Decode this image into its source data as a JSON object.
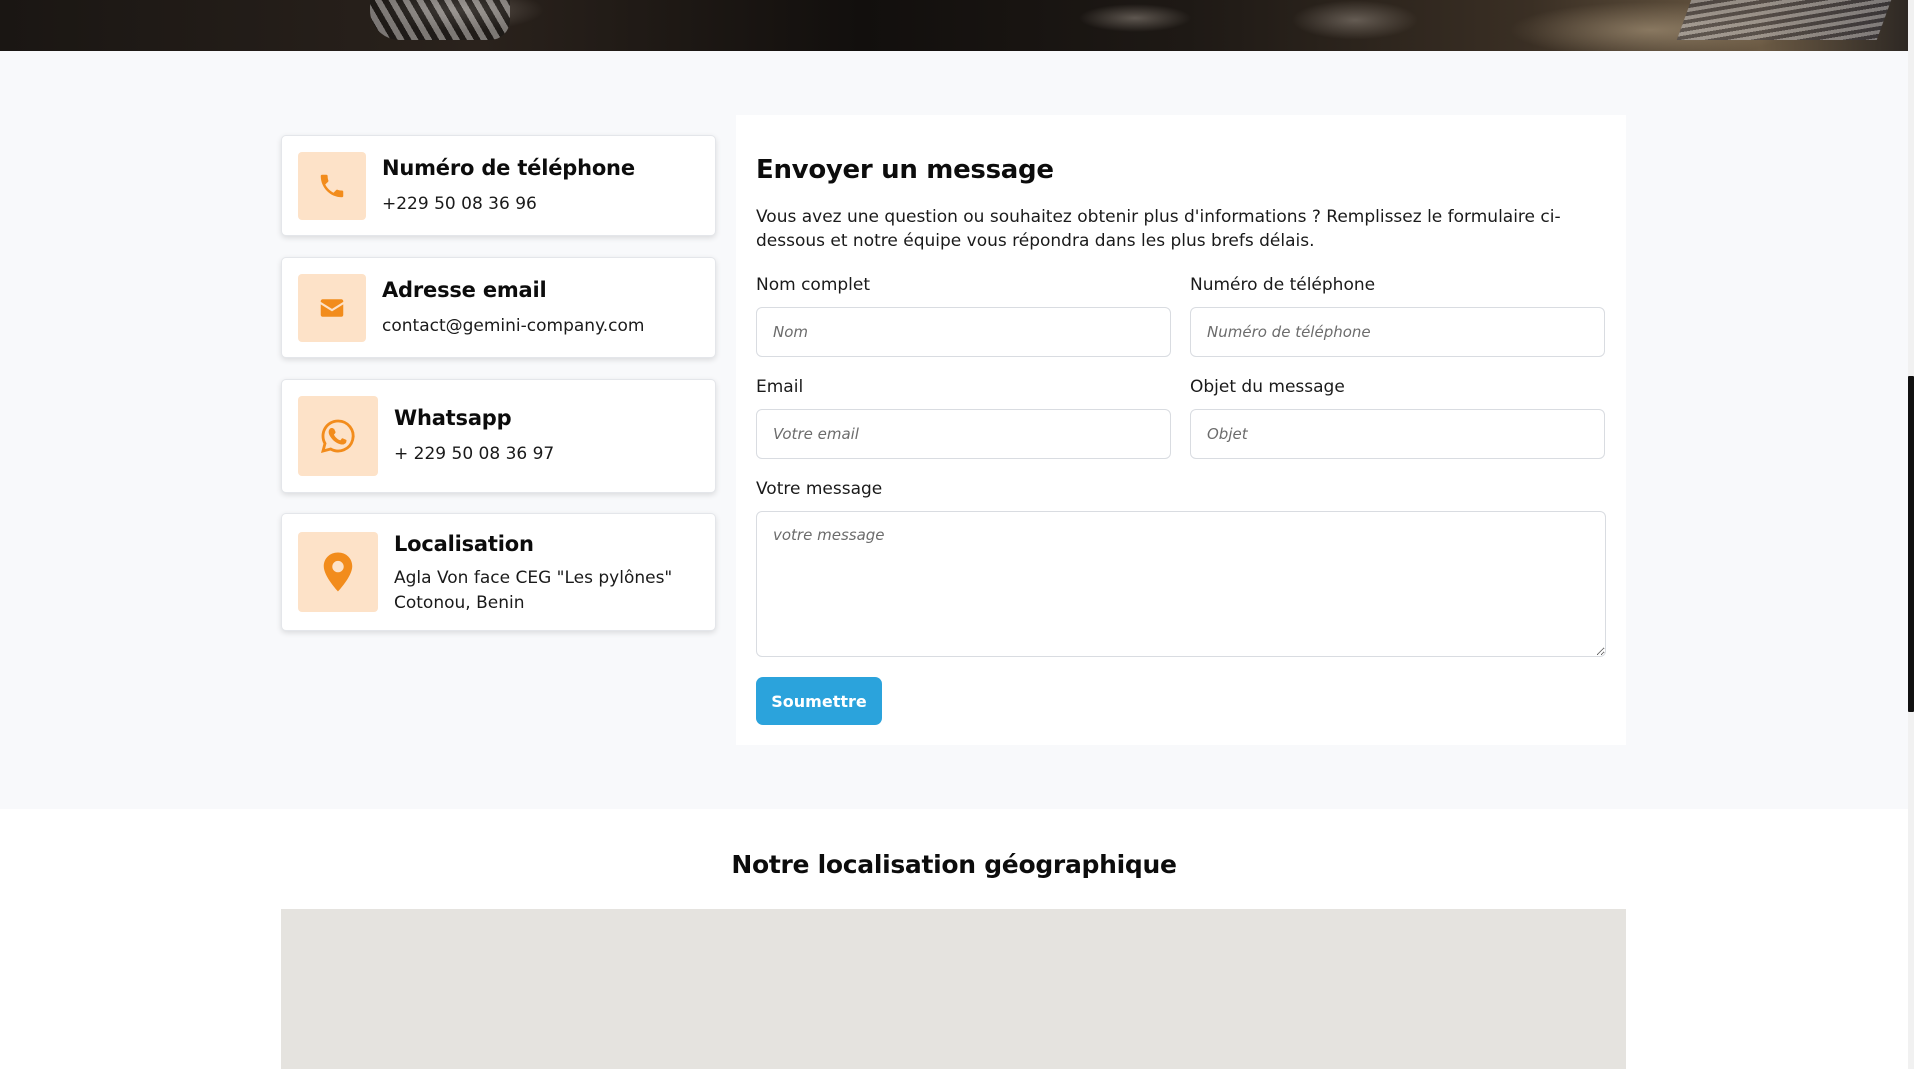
{
  "contact_cards": [
    {
      "icon": "phone-icon",
      "title": "Numéro de téléphone",
      "lines": [
        "+229 50 08 36 96"
      ]
    },
    {
      "icon": "envelope-icon",
      "title": "Adresse email",
      "lines": [
        "contact@gemini-company.com"
      ]
    },
    {
      "icon": "whatsapp-icon",
      "title": "Whatsapp",
      "lines": [
        "+ 229 50 08 36 97"
      ]
    },
    {
      "icon": "map-pin-icon",
      "title": "Localisation",
      "lines": [
        "Agla Von face CEG \"Les pylônes\"",
        "Cotonou, Benin"
      ]
    }
  ],
  "form": {
    "title": "Envoyer un message",
    "description": "Vous avez une question ou souhaitez obtenir plus d'informations ? Remplissez le formulaire ci-dessous et notre équipe vous répondra dans les plus brefs délais.",
    "fields": {
      "name": {
        "label": "Nom complet",
        "placeholder": "Nom",
        "value": ""
      },
      "phone": {
        "label": "Numéro de téléphone",
        "placeholder": "Numéro de téléphone",
        "value": ""
      },
      "email": {
        "label": "Email",
        "placeholder": "Votre email",
        "value": ""
      },
      "subject": {
        "label": "Objet du message",
        "placeholder": "Objet",
        "value": ""
      },
      "message": {
        "label": "Votre message",
        "placeholder": "votre message",
        "value": ""
      }
    },
    "submit_label": "Soumettre"
  },
  "map_section": {
    "title": "Notre localisation géographique"
  },
  "colors": {
    "accent_orange": "#f28c1c",
    "icon_bg": "#fde2c8",
    "button_blue": "#2ba3dc",
    "section_bg": "#f8f9fb",
    "map_bg": "#e5e3df"
  }
}
